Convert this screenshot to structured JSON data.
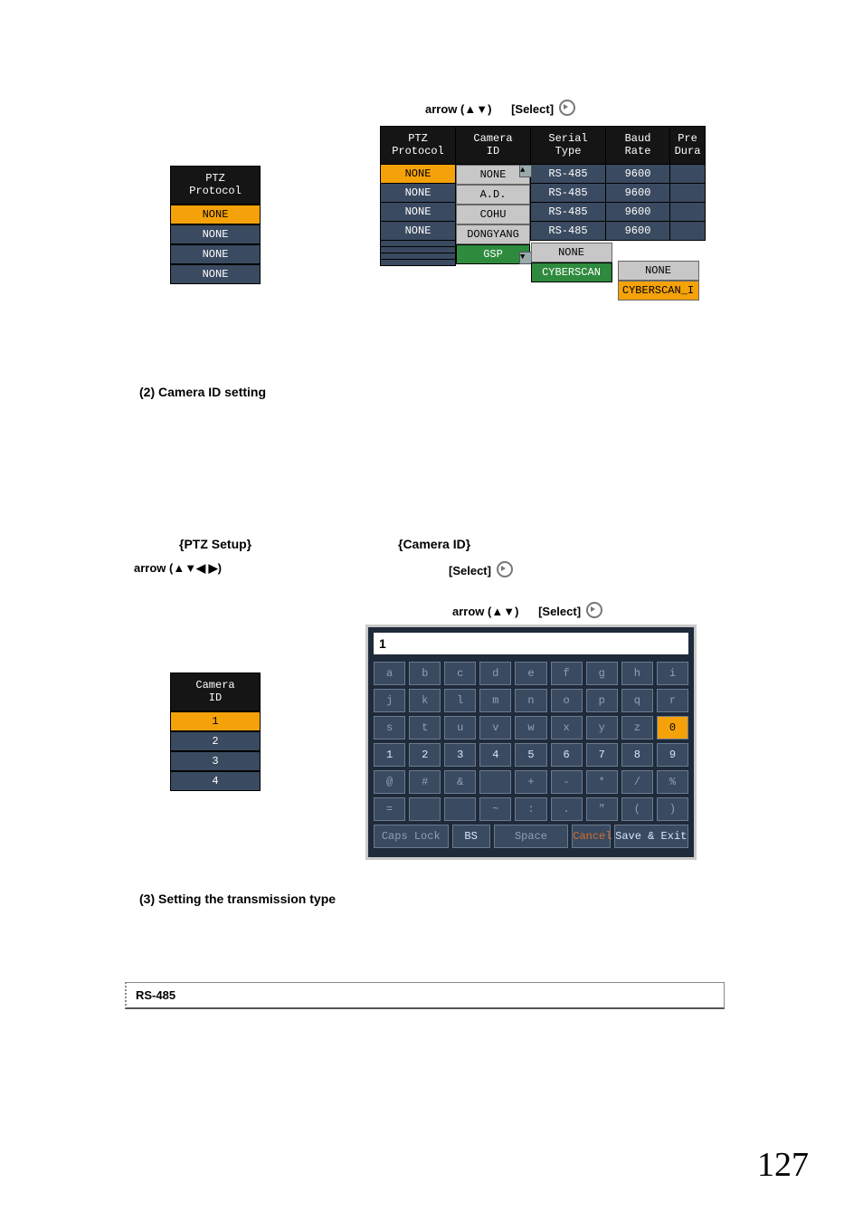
{
  "nav": {
    "arrow_ud": "arrow (▲▼)",
    "arrow_all": "arrow (▲▼◀ ▶)",
    "select": "[Select]"
  },
  "sections": {
    "s2": "(2) Camera ID setting",
    "ptz_setup": "{PTZ Setup}",
    "camera_id": "{Camera ID}",
    "s3": "(3) Setting the transmission type",
    "rs485": "RS-485"
  },
  "ptz_proto_small": {
    "header": "PTZ\nProtocol",
    "rows": [
      "NONE",
      "NONE",
      "NONE",
      "NONE"
    ],
    "hi_index": 0
  },
  "big_table": {
    "headers": [
      "PTZ\nProtocol",
      "Camera\nID",
      "Serial\nType",
      "Baud\nRate",
      "Pre\nDura"
    ],
    "ptz_col": [
      "NONE",
      "NONE",
      "NONE",
      "NONE"
    ],
    "serial_col": [
      "RS-485",
      "RS-485",
      "RS-485",
      "RS-485"
    ],
    "baud_col": [
      "9600",
      "9600",
      "9600",
      "9600"
    ],
    "camera_dropdown": [
      "NONE",
      "A.D.",
      "COHU",
      "DONGYANG",
      "GSP"
    ],
    "serial_dropdown": [
      "NONE",
      "CYBERSCAN"
    ],
    "baud_dropdown": [
      "NONE",
      "CYBERSCAN_I"
    ]
  },
  "camera_id_small": {
    "header": "Camera\nID",
    "rows": [
      "1",
      "2",
      "3",
      "4"
    ],
    "hi_index": 0
  },
  "kbd": {
    "display": "1",
    "rows": [
      [
        "a",
        "b",
        "c",
        "d",
        "e",
        "f",
        "g",
        "h",
        "i"
      ],
      [
        "j",
        "k",
        "l",
        "m",
        "n",
        "o",
        "p",
        "q",
        "r"
      ],
      [
        "s",
        "t",
        "u",
        "v",
        "w",
        "x",
        "y",
        "z",
        "0"
      ],
      [
        "1",
        "2",
        "3",
        "4",
        "5",
        "6",
        "7",
        "8",
        "9"
      ],
      [
        "@",
        "#",
        "&",
        "",
        "+",
        "-",
        "*",
        "/",
        "%"
      ],
      [
        "=",
        "",
        "",
        "~",
        ":",
        ".",
        "\"",
        "(",
        ")"
      ]
    ],
    "bottom": {
      "caps": "Caps Lock",
      "bs": "BS",
      "space": "Space",
      "cancel": "Cancel",
      "save": "Save & Exit"
    },
    "hi_key": "0",
    "bright_row_index": 3
  },
  "page_number": "127"
}
